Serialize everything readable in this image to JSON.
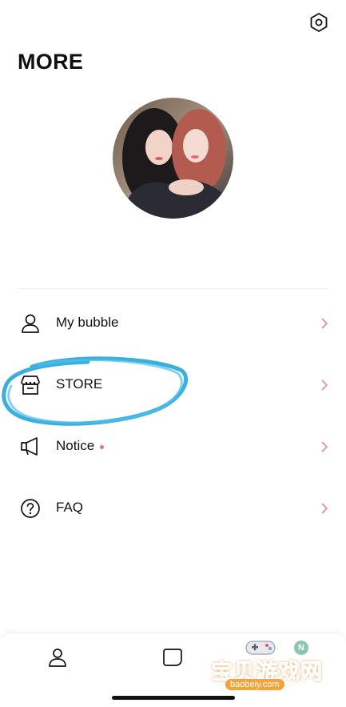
{
  "header": {
    "title": "MORE",
    "settings_icon": "gear-icon"
  },
  "profile": {
    "avatar_icon": "profile-photo"
  },
  "menu": {
    "items": [
      {
        "label": "My bubble",
        "icon": "person-icon",
        "has_dot": false
      },
      {
        "label": "STORE",
        "icon": "store-icon",
        "has_dot": false
      },
      {
        "label": "Notice",
        "icon": "megaphone-icon",
        "has_dot": true
      },
      {
        "label": "FAQ",
        "icon": "help-circle-icon",
        "has_dot": false
      }
    ]
  },
  "tabbar": {
    "tabs": [
      {
        "icon": "profile-tab-icon"
      },
      {
        "icon": "chat-tab-icon"
      },
      {
        "icon": "notification-tab-icon",
        "badge": "N"
      }
    ]
  },
  "watermark": {
    "text": "宝贝游戏网",
    "domain": "baobeiy.com"
  },
  "colors": {
    "accent_pink": "#f06a8c",
    "chevron": "#e8879d",
    "annotation_blue": "#27a6dc",
    "text": "#111111"
  }
}
